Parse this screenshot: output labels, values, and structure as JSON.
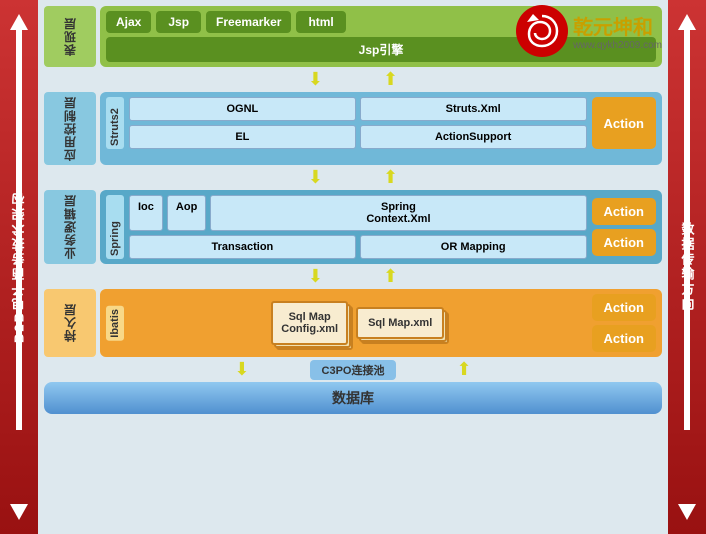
{
  "layout": {
    "left_label": "B2B电子商务技术架构",
    "right_label": "数据传输方向"
  },
  "presentation_layer": {
    "label": "表现层",
    "items_row1": [
      "Ajax",
      "Jsp",
      "Freemarker",
      "html"
    ],
    "items_row2": "Jsp引擎"
  },
  "app_control_layer": {
    "label": "应用控制层",
    "framework_label": "Struts2",
    "boxes": [
      "OGNL",
      "Struts.Xml",
      "EL",
      "ActionSupport"
    ],
    "action": "Action"
  },
  "business_layer": {
    "label": "业务逻辑层",
    "framework_label": "Spring",
    "row1": [
      "Ioc",
      "Aop",
      "Spring\nContext.Xml"
    ],
    "row2": [
      "Transaction",
      "OR Mapping"
    ],
    "actions": [
      "Action",
      "Action"
    ]
  },
  "persistence_layer": {
    "label": "持久层",
    "framework_label": "Ibatis",
    "boxes": [
      "Sql Map\nConfig.xml",
      "Sql Map.xml"
    ],
    "actions": [
      "Action",
      "Action"
    ]
  },
  "connection_pool": {
    "label": "C3PO连接池"
  },
  "database": {
    "label": "数据库"
  },
  "logo": {
    "brand": "乾元坤和",
    "url": "www.qykh2009.com"
  }
}
